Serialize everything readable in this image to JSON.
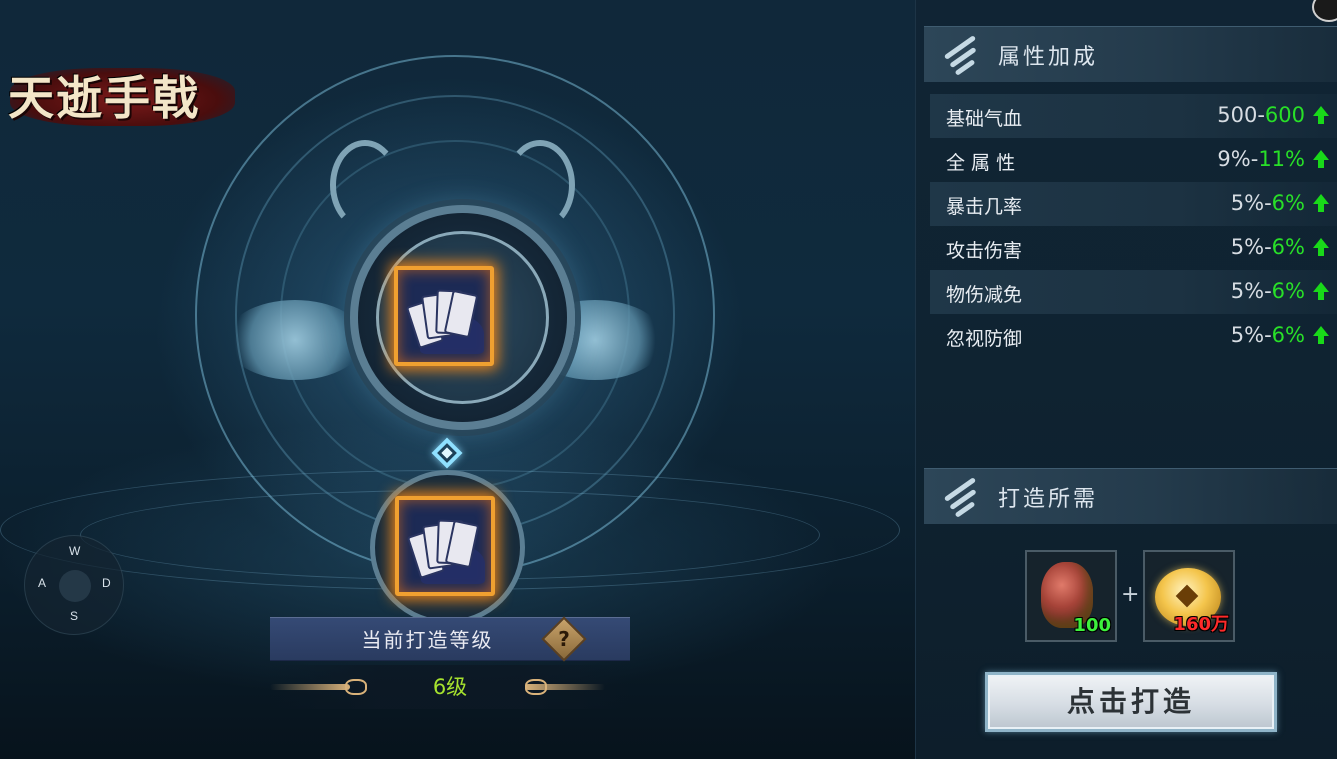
{
  "logo": {
    "text": "天逝手戟"
  },
  "forge": {
    "current_level_title": "当前打造等级",
    "current_level_value": "6级",
    "help_icon_glyph": "?"
  },
  "joystick": {
    "up": "W",
    "left": "A",
    "right": "D",
    "down": "S"
  },
  "attributes": {
    "title": "属性加成",
    "rows": [
      {
        "name": "基础气血",
        "from": "500-",
        "to": "600"
      },
      {
        "name": "全 属 性",
        "from": "9%-",
        "to": "11%"
      },
      {
        "name": "暴击几率",
        "from": "5%-",
        "to": "6%"
      },
      {
        "name": "攻击伤害",
        "from": "5%-",
        "to": "6%"
      },
      {
        "name": "物伤减免",
        "from": "5%-",
        "to": "6%"
      },
      {
        "name": "忽视防御",
        "from": "5%-",
        "to": "6%"
      }
    ]
  },
  "requirements": {
    "title": "打造所需",
    "materials": [
      {
        "icon": "ore-stone-icon",
        "count": "100",
        "sufficient": true
      },
      {
        "icon": "gold-coin-icon",
        "count": "160万",
        "sufficient": false
      }
    ],
    "plus": "+"
  },
  "forge_button": {
    "label": "点击打造"
  },
  "colors": {
    "increase": "#28e028",
    "insufficient": "#ff2a2a",
    "level": "#a6e22e"
  }
}
